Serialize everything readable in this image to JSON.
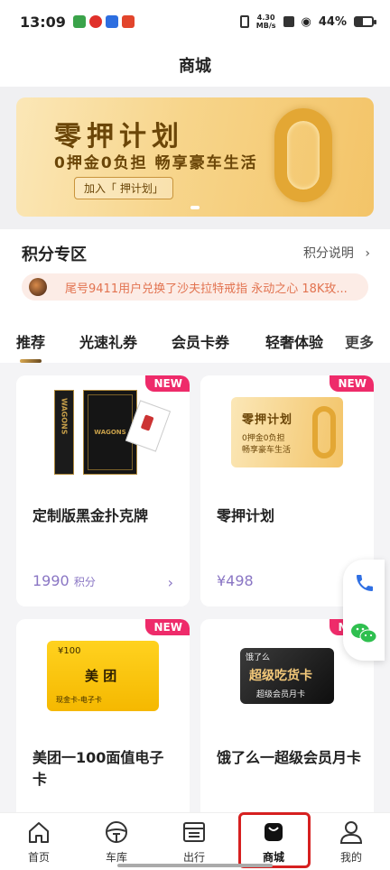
{
  "statusbar": {
    "time": "13:09",
    "speed_top": "4.30",
    "speed_bottom": "MB/s",
    "battery": "44%",
    "battery_fraction": 0.44
  },
  "header": {
    "title": "商城"
  },
  "banner": {
    "title": "零押计划",
    "subtitle": "0押金0负担 畅享豪车生活",
    "join_label": "加入「 押计划」"
  },
  "points": {
    "title": "积分专区",
    "link": "积分说明",
    "ticker": "尾号9411用户兑换了沙夫拉特戒指 永动之心 18K玫..."
  },
  "tabs": {
    "items": [
      "推荐",
      "光速礼券",
      "会员卡券",
      "轻奢体验"
    ],
    "more": "更多"
  },
  "products": [
    {
      "badge": "NEW",
      "name": "定制版黑金扑克牌",
      "price": "1990",
      "price_unit": "积分",
      "image_text_a": "WAGONS",
      "image_text_b": "WAGONS"
    },
    {
      "badge": "NEW",
      "name": "零押计划",
      "price": "¥498",
      "image_title": "零押计划",
      "image_sub_1": "0押金0负担",
      "image_sub_2": "畅享豪车生活"
    },
    {
      "badge": "NEW",
      "name": "美团一100面值电子卡",
      "image_value": "¥100",
      "image_logo": "美 团",
      "image_label": "现金卡-电子卡"
    },
    {
      "badge": "NEW",
      "name": "饿了么一超级会员月卡",
      "image_top": "饿了么",
      "image_big": "超级吃货卡",
      "image_small": "超级会员月卡"
    }
  ],
  "bottomnav": {
    "items": [
      {
        "label": "首页",
        "icon": "home-icon"
      },
      {
        "label": "车库",
        "icon": "steering-wheel-icon"
      },
      {
        "label": "出行",
        "icon": "calendar-icon"
      },
      {
        "label": "商城",
        "icon": "shopping-bag-icon"
      },
      {
        "label": "我的",
        "icon": "person-icon"
      }
    ]
  },
  "colors": {
    "accent": "#8a76c4",
    "badge": "#ee2b6a",
    "gold": "#e3a734",
    "ticker_text": "#e27350"
  }
}
